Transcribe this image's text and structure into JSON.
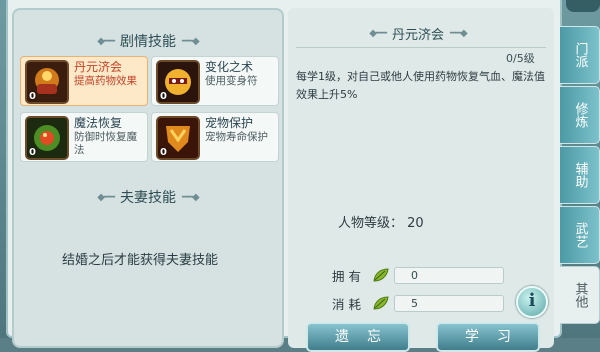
{
  "left": {
    "plot_skills_title": "剧情技能",
    "skills": [
      {
        "name": "丹元济会",
        "desc": "提高药物效果",
        "level": "0",
        "icon": "pill-cauldron-icon"
      },
      {
        "name": "变化之术",
        "desc": "使用变身符",
        "level": "0",
        "icon": "transform-mask-icon"
      },
      {
        "name": "魔法恢复",
        "desc": "防御时恢复魔法",
        "level": "0",
        "icon": "magic-orb-icon"
      },
      {
        "name": "宠物保护",
        "desc": "宠物寿命保护",
        "level": "0",
        "icon": "pet-shield-icon"
      }
    ],
    "spouse_skills_title": "夫妻技能",
    "spouse_message": "结婚之后才能获得夫妻技能"
  },
  "detail": {
    "title": "丹元济会",
    "level_count": "0/5级",
    "description": "每学1级，对自己或他人使用药物恢复气血、魔法值效果上升5%",
    "char_level_label": "人物等级：",
    "char_level_value": "20",
    "own_label": "拥有",
    "own_value": "0",
    "cost_label": "消耗",
    "cost_value": "5",
    "info_button": "i",
    "forget_button": "遗忘",
    "learn_button": "学习"
  },
  "tabs": [
    "门派",
    "修炼",
    "辅助",
    "武艺",
    "其他"
  ],
  "active_tab": "其他",
  "colors": {
    "accent": "#c0442a",
    "tab": "#4b9aa5",
    "button": "#417e8c"
  }
}
